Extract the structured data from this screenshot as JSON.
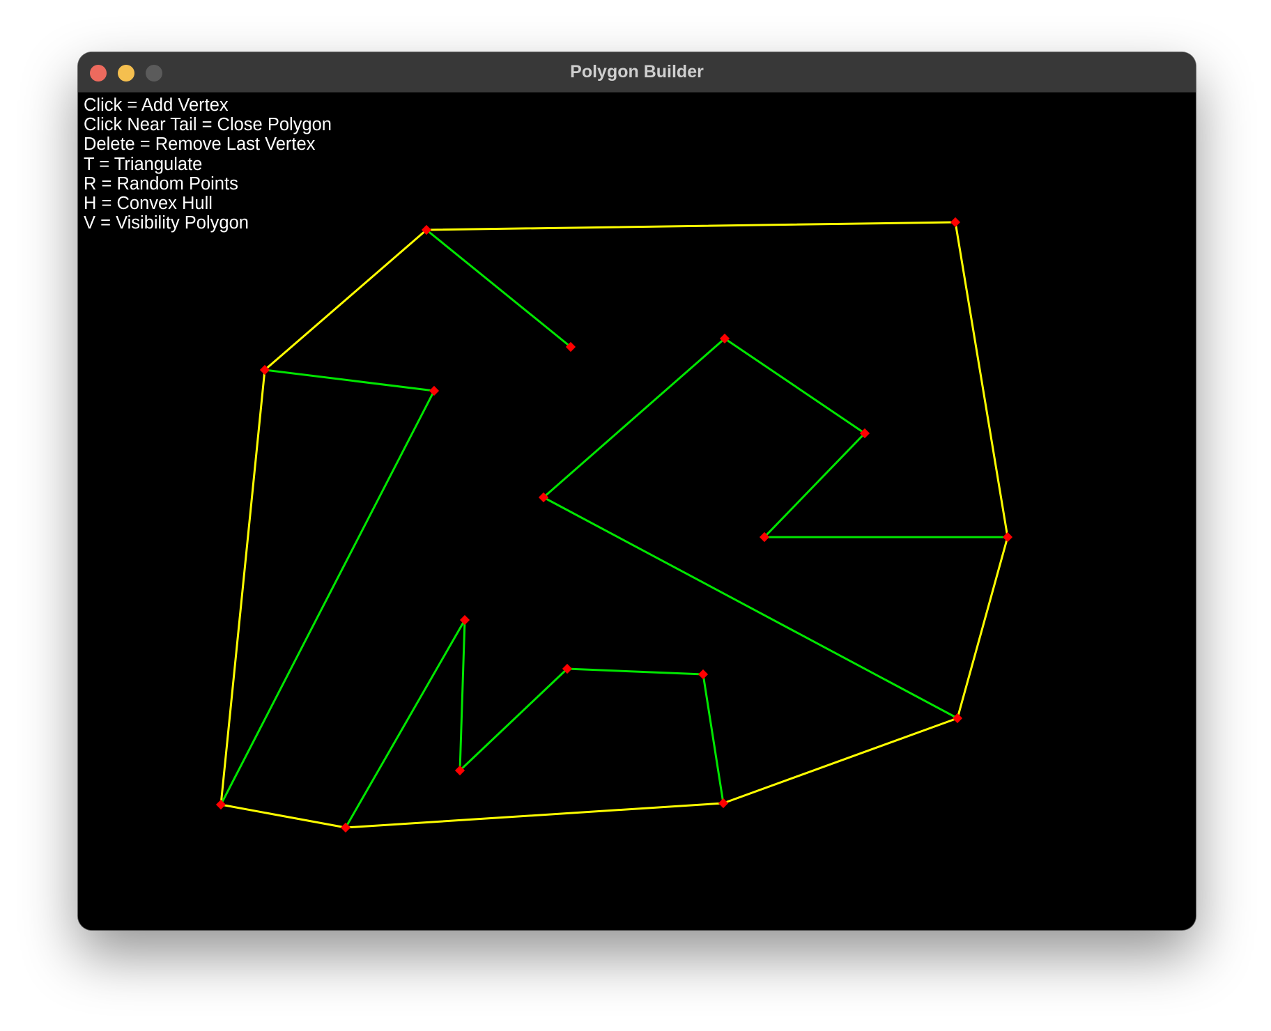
{
  "window": {
    "title": "Polygon Builder"
  },
  "colors": {
    "traffic_close": "#ed6a5e",
    "traffic_minimize": "#f5bf4f",
    "traffic_zoom": "#5b5b5b",
    "canvas_background": "#000000",
    "hull_edge": "#ffff00",
    "polygon_edge": "#00e600",
    "vertex": "#ff0000",
    "help_text": "#ffffff"
  },
  "help_lines": [
    "Click = Add Vertex",
    "Click Near Tail = Close Polygon",
    "Delete = Remove Last Vertex",
    "T = Triangulate",
    "R = Random Points",
    "H = Convex Hull",
    "V = Visibility Polygon"
  ]
}
